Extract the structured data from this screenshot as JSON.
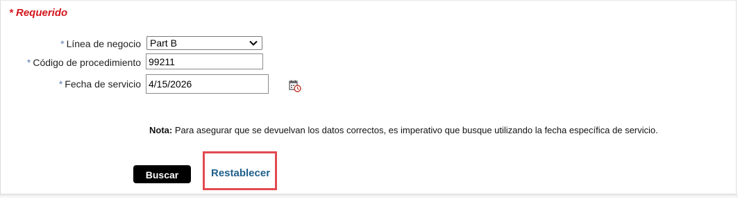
{
  "form": {
    "required_note": "* Requerido",
    "line_of_business": {
      "label": "Línea de negocio",
      "selected": "Part B"
    },
    "procedure_code": {
      "label": "Código de procedimiento",
      "value": "99211"
    },
    "service_date": {
      "label": "Fecha de servicio",
      "value": "4/15/2026"
    },
    "required_marker": "*",
    "note_title": "Nota:",
    "note_text": "Para asegurar que se devuelvan los datos correctos, es imperativo que busque utilizando la fecha específica de servicio.",
    "search_label": "Buscar",
    "reset_label": "Restablecer"
  },
  "icons": {
    "calendar": "calendar-clock-icon",
    "dropdown": "chevron-down-icon"
  },
  "colors": {
    "required_red": "#d2161c",
    "link_blue": "#1f5f8b",
    "star_blue": "#5b7fa8",
    "highlight_red": "#e2494f"
  }
}
